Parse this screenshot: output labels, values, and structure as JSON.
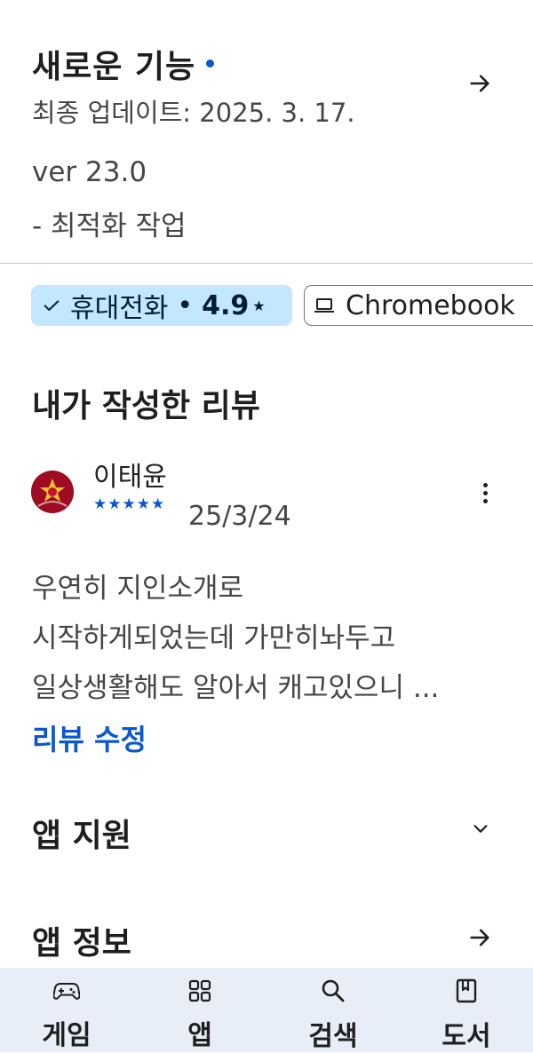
{
  "whats_new": {
    "title": "새로운 기능",
    "updated": "최종 업데이트: 2025. 3. 17.",
    "notes": [
      "ver 23.0",
      "- 최적화 작업"
    ]
  },
  "device_chips": [
    {
      "label": "휴대전화",
      "separator": "•",
      "rating": "4.9",
      "star": "★",
      "selected": true,
      "icon": "check-icon"
    },
    {
      "label": "Chromebook",
      "selected": false,
      "icon": "laptop-icon"
    }
  ],
  "my_review": {
    "section_title": "내가 작성한 리뷰",
    "reviewer": "이태윤",
    "stars": "★★★★★",
    "star_count": 5,
    "date": "25/3/24",
    "text_lines": [
      "우연히 지인소개로",
      "시작하게되었는데 가만히놔두고",
      "일상생활해도 알아서 캐고있으니 ..."
    ],
    "edit_label": "리뷰 수정"
  },
  "app_support": {
    "title": "앱 지원",
    "icon": "chevron-down-icon"
  },
  "app_info": {
    "title": "앱 정보",
    "icon": "arrow-right-icon"
  },
  "bottom_nav": [
    {
      "label": "게임",
      "icon": "gamepad-icon"
    },
    {
      "label": "앱",
      "icon": "apps-grid-icon"
    },
    {
      "label": "검색",
      "icon": "search-icon"
    },
    {
      "label": "도서",
      "icon": "book-icon"
    }
  ],
  "colors": {
    "accent": "#0b57d0",
    "chip_selected_bg": "#c2e7ff",
    "nav_bg": "#e8eef7",
    "text": "#1f1f1f",
    "secondary_text": "#444746"
  }
}
